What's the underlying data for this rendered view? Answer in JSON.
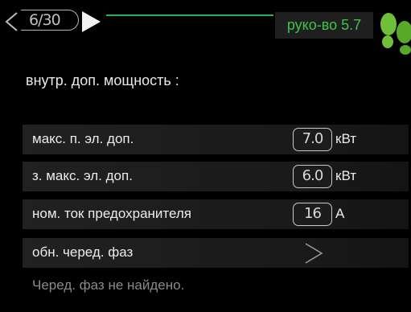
{
  "header": {
    "counter": "6/30",
    "manual_label": "руко-во 5.7"
  },
  "section": {
    "title": "внутр. доп. мощность :"
  },
  "rows": [
    {
      "label": "макс. п. эл. доп.",
      "value": "7.0",
      "unit": "кВт"
    },
    {
      "label": "з. макс. эл. доп.",
      "value": "6.0",
      "unit": "кВт"
    },
    {
      "label": "ном. ток предохранителя",
      "value": "16",
      "unit": "A"
    },
    {
      "label": "обн. черед. фаз"
    }
  ],
  "footer": {
    "status": "Черед. фаз не найдено."
  },
  "colors": {
    "accent_green": "#2bb24c",
    "manual_label_bg": "#1f1f1f",
    "background": "#000000"
  },
  "icons": {
    "nav_left": "chevron-left-icon",
    "nav_right": "play-right-icon",
    "logo": "footprints-logo-icon",
    "row_arrow": "chevron-right-icon"
  }
}
